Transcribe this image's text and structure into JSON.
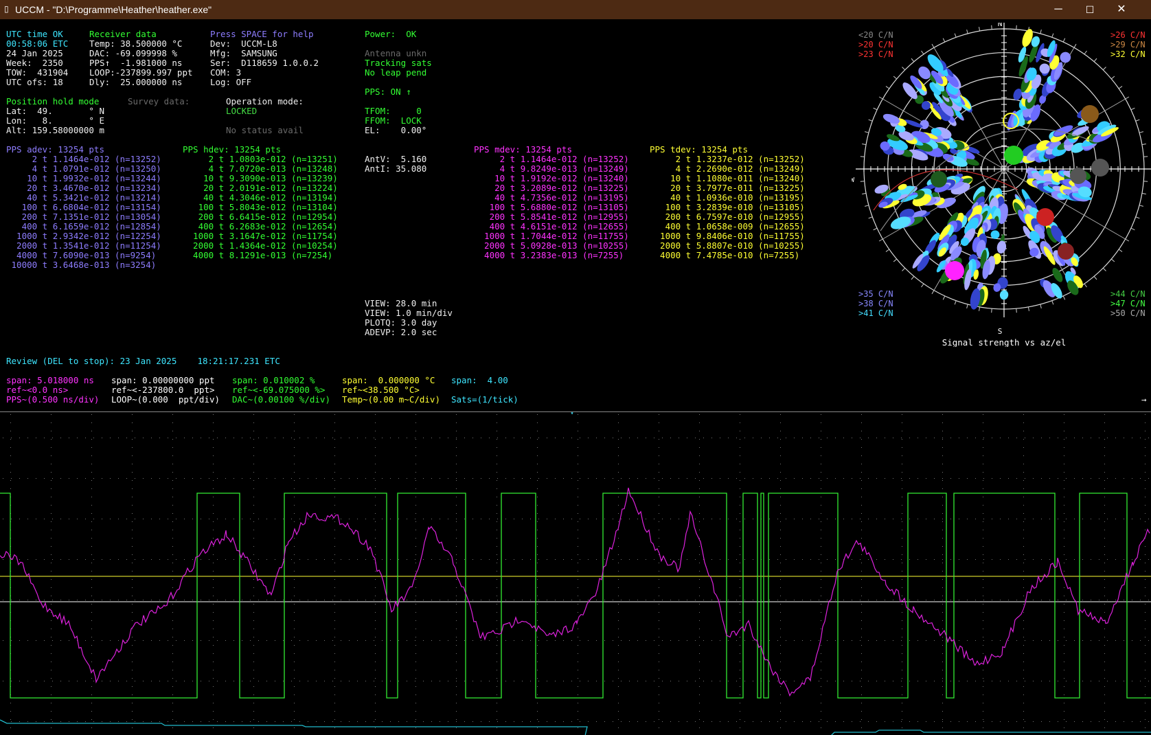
{
  "window": {
    "title": "UCCM - \"D:\\Programme\\Heather\\heather.exe\"",
    "app_icon": "app-icon",
    "minimize": "─",
    "maximize": "☐",
    "close": "✕"
  },
  "status": {
    "utc_label": "UTC time OK",
    "time": "00:58:06 ETC",
    "date": "24 Jan 2025",
    "week": "Week:  2350",
    "tow": "TOW:  431904",
    "utc_ofs": "UTC ofs: 18"
  },
  "receiver": {
    "header": "Receiver data",
    "lines": [
      "Temp: 38.500000 °C",
      "DAC: -69.099998 %",
      "PPS↑  -1.981000 ns",
      "LOOP:-237899.997 ppt",
      "Dly:  25.000000 ns"
    ]
  },
  "device": {
    "header": "Press SPACE for help",
    "lines": [
      "Dev:  UCCM-L8",
      "Mfg:  SAMSUNG",
      "Ser:  D118659 1.0.0.2",
      "COM: 3",
      "Log: OFF"
    ]
  },
  "power": {
    "power": "Power:  OK",
    "antenna": "Antenna unkn",
    "tracking": "Tracking sats",
    "leap": "No leap pend",
    "pps": "PPS: ON ↑",
    "tfom": "TFOM:     0",
    "ffom": "FFOM:  LOCK",
    "el": "EL:    0.00°",
    "antv": "AntV:  5.160",
    "anti": "AntI: 35.080"
  },
  "position": {
    "header": "Position hold mode",
    "lat": "Lat:  49.       ° N",
    "lon": "Lon:   8.       ° E",
    "alt": "Alt: 159.58000000 m",
    "survey": "Survey data:",
    "op_label": "Operation mode:",
    "op_value": "LOCKED",
    "no_status": "No status avail"
  },
  "adev": {
    "header": "PPS adev: 13254 pts",
    "rows": [
      "     2 t 1.1464e-012 (n=13252)",
      "     4 t 1.0791e-012 (n=13250)",
      "    10 t 1.9932e-012 (n=13244)",
      "    20 t 3.4670e-012 (n=13234)",
      "    40 t 5.3421e-012 (n=13214)",
      "   100 t 6.6804e-012 (n=13154)",
      "   200 t 7.1351e-012 (n=13054)",
      "   400 t 6.1659e-012 (n=12854)",
      "  1000 t 2.9342e-012 (n=12254)",
      "  2000 t 1.3541e-012 (n=11254)",
      "  4000 t 7.6090e-013 (n=9254)",
      " 10000 t 3.6468e-013 (n=3254)"
    ]
  },
  "hdev": {
    "header": "PPS hdev: 13254 pts",
    "rows": [
      "     2 t 1.0803e-012 (n=13251)",
      "     4 t 7.0720e-013 (n=13248)",
      "    10 t 9.3090e-013 (n=13239)",
      "    20 t 2.0191e-012 (n=13224)",
      "    40 t 4.3046e-012 (n=13194)",
      "   100 t 5.8043e-012 (n=13104)",
      "   200 t 6.6415e-012 (n=12954)",
      "   400 t 6.2683e-012 (n=12654)",
      "  1000 t 3.1647e-012 (n=11754)",
      "  2000 t 1.4364e-012 (n=10254)",
      "  4000 t 8.1291e-013 (n=7254)"
    ]
  },
  "mdev": {
    "header": "PPS mdev: 13254 pts",
    "rows": [
      "     2 t 1.1464e-012 (n=13252)",
      "     4 t 9.8249e-013 (n=13249)",
      "    10 t 1.9192e-012 (n=13240)",
      "    20 t 3.2089e-012 (n=13225)",
      "    40 t 4.7356e-012 (n=13195)",
      "   100 t 5.6880e-012 (n=13105)",
      "   200 t 5.8541e-012 (n=12955)",
      "   400 t 4.6151e-012 (n=12655)",
      "  1000 t 1.7044e-012 (n=11755)",
      "  2000 t 5.0928e-013 (n=10255)",
      "  4000 t 3.2383e-013 (n=7255)"
    ]
  },
  "tdev": {
    "header": "PPS tdev: 13254 pts",
    "rows": [
      "     2 t 1.3237e-012 (n=13252)",
      "     4 t 2.2690e-012 (n=13249)",
      "    10 t 1.1080e-011 (n=13240)",
      "    20 t 3.7977e-011 (n=13225)",
      "    40 t 1.0936e-010 (n=13195)",
      "   100 t 3.2839e-010 (n=13105)",
      "   200 t 6.7597e-010 (n=12955)",
      "   400 t 1.0658e-009 (n=12655)",
      "  1000 t 9.8406e-010 (n=11755)",
      "  2000 t 5.8807e-010 (n=10255)",
      "  4000 t 7.4785e-010 (n=7255)"
    ]
  },
  "view": {
    "lines": [
      "VIEW: 28.0 min",
      "VIEW: 1.0 min/div",
      "PLOTQ: 3.0 day",
      "ADEVP: 2.0 sec"
    ]
  },
  "polar": {
    "title": "Signal strength vs az/el",
    "compass": {
      "n": "N",
      "s": "S",
      "w": "W"
    },
    "legend_tl": [
      "<20 C/N",
      ">20 C/N",
      ">23 C/N"
    ],
    "legend_tr": [
      ">26 C/N",
      ">29 C/N",
      ">32 C/N"
    ],
    "legend_bl": [
      ">35 C/N",
      ">38 C/N",
      ">41 C/N"
    ],
    "legend_br": [
      ">44 C/N",
      ">47 C/N",
      ">50 C/N"
    ],
    "colors": {
      "lt20": "#888888",
      "gt20": "#ff3333",
      "gt23": "#ff3333",
      "gt26": "#ff3333",
      "gt29": "#cc8844",
      "gt32": "#ffff33",
      "gt35": "#8888ff",
      "gt38": "#8888ff",
      "gt41": "#44ddff",
      "gt44": "#44cc44",
      "gt47": "#44ff44",
      "gt50": "#aaaaaa"
    }
  },
  "review": {
    "line": "Review (DEL to stop): 23 Jan 2025    18:21:17.231 ETC"
  },
  "scales": {
    "row1": [
      {
        "text": "span: 5.018000 ns",
        "color": "#ff33ff"
      },
      {
        "text": "span: 0.00000000 ppt",
        "color": "#ffffff"
      },
      {
        "text": "span: 0.010002 %",
        "color": "#33ff33"
      },
      {
        "text": "span:  0.000000 °C",
        "color": "#ffff33"
      },
      {
        "text": "span:  4.00",
        "color": "#3ee6ff"
      }
    ],
    "row2": [
      {
        "text": "ref~<0.0 ns>",
        "color": "#ff33ff"
      },
      {
        "text": "ref~<-237800.0  ppt>",
        "color": "#ffffff"
      },
      {
        "text": "ref~<-69.075000 %>",
        "color": "#33ff33"
      },
      {
        "text": "ref~<38.500 °C>",
        "color": "#ffff33"
      }
    ],
    "row3": [
      {
        "text": "PPS~(0.500 ns/div)",
        "color": "#ff33ff"
      },
      {
        "text": "LOOP~(0.000  ppt/div)",
        "color": "#ffffff"
      },
      {
        "text": "DAC~(0.00100 %/div)",
        "color": "#33ff33"
      },
      {
        "text": "Temp~(0.00 m~C/div)",
        "color": "#ffff33"
      },
      {
        "text": "Sats=(1/tick)",
        "color": "#3ee6ff"
      }
    ],
    "arrow": "→"
  }
}
